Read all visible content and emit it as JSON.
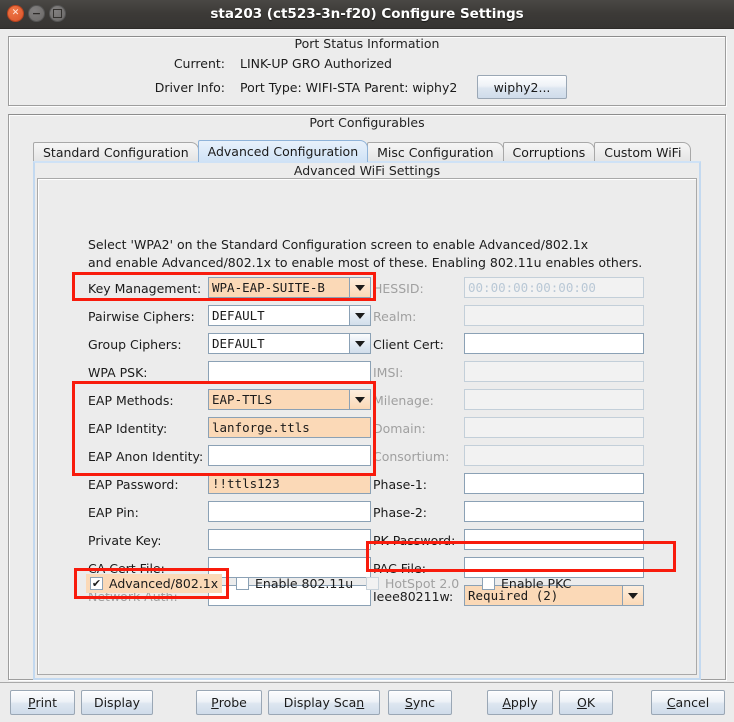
{
  "window": {
    "title": "sta203  (ct523-3n-f20) Configure Settings",
    "controls": [
      {
        "name": "close-button",
        "glyph": "✕"
      },
      {
        "name": "minimize-button",
        "glyph": "−"
      },
      {
        "name": "maximize-button",
        "glyph": ""
      }
    ]
  },
  "port_status": {
    "group_title": "Port Status Information",
    "current_label": "Current:",
    "current_value": "LINK-UP GRO  Authorized",
    "driver_label": "Driver Info:",
    "driver_value": "Port Type: WIFI-STA   Parent: wiphy2",
    "wiphy_button": "wiphy2..."
  },
  "configurables": {
    "group_title": "Port Configurables",
    "tabs": [
      {
        "label": "Standard Configuration",
        "active": false
      },
      {
        "label": "Advanced Configuration",
        "active": true
      },
      {
        "label": "Misc Configuration",
        "active": false
      },
      {
        "label": "Corruptions",
        "active": false
      },
      {
        "label": "Custom WiFi",
        "active": false
      }
    ],
    "panel_title": "Advanced WiFi Settings"
  },
  "hint": {
    "line1": "Select 'WPA2' on the Standard Configuration screen to enable Advanced/802.1x",
    "line2": "and enable Advanced/802.1x to enable most of these. Enabling 802.11u enables others."
  },
  "left_fields": [
    {
      "label": "Key Management:",
      "type": "combo",
      "value": "WPA-EAP-SUITE-B",
      "filled": true,
      "disabled": false
    },
    {
      "label": "Pairwise Ciphers:",
      "type": "combo",
      "value": "DEFAULT",
      "filled": false,
      "disabled": false
    },
    {
      "label": "Group Ciphers:",
      "type": "combo",
      "value": "DEFAULT",
      "filled": false,
      "disabled": false
    },
    {
      "label": "WPA PSK:",
      "type": "text",
      "value": "",
      "filled": false,
      "disabled": false
    },
    {
      "label": "EAP Methods:",
      "type": "combo",
      "value": "EAP-TTLS",
      "filled": true,
      "disabled": false
    },
    {
      "label": "EAP Identity:",
      "type": "text",
      "value": "lanforge.ttls",
      "filled": true,
      "disabled": false
    },
    {
      "label": "EAP Anon Identity:",
      "type": "text",
      "value": "",
      "filled": false,
      "disabled": false
    },
    {
      "label": "EAP Password:",
      "type": "text",
      "value": "!!ttls123",
      "filled": true,
      "disabled": false
    },
    {
      "label": "EAP Pin:",
      "type": "text",
      "value": "",
      "filled": false,
      "disabled": false
    },
    {
      "label": "Private Key:",
      "type": "text",
      "value": "",
      "filled": false,
      "disabled": false
    },
    {
      "label": "CA Cert File:",
      "type": "text",
      "value": "",
      "filled": false,
      "disabled": false
    },
    {
      "label": "Network Auth:",
      "type": "text",
      "value": "",
      "filled": false,
      "disabled": true
    }
  ],
  "right_fields": [
    {
      "label": "HESSID:",
      "type": "text",
      "value": "00:00:00:00:00:00",
      "filled": false,
      "disabled": true,
      "placeholder_style": true
    },
    {
      "label": "Realm:",
      "type": "text",
      "value": "",
      "filled": false,
      "disabled": true
    },
    {
      "label": "Client Cert:",
      "type": "text",
      "value": "",
      "filled": false,
      "disabled": false
    },
    {
      "label": "IMSI:",
      "type": "text",
      "value": "",
      "filled": false,
      "disabled": true
    },
    {
      "label": "Milenage:",
      "type": "text",
      "value": "",
      "filled": false,
      "disabled": true
    },
    {
      "label": "Domain:",
      "type": "text",
      "value": "",
      "filled": false,
      "disabled": true
    },
    {
      "label": "Consortium:",
      "type": "text",
      "value": "",
      "filled": false,
      "disabled": true
    },
    {
      "label": "Phase-1:",
      "type": "text",
      "value": "",
      "filled": false,
      "disabled": false
    },
    {
      "label": "Phase-2:",
      "type": "text",
      "value": "",
      "filled": false,
      "disabled": false
    },
    {
      "label": "PK Password:",
      "type": "text",
      "value": "",
      "filled": false,
      "disabled": false
    },
    {
      "label": "PAC File:",
      "type": "text",
      "value": "",
      "filled": false,
      "disabled": false
    },
    {
      "label": "Ieee80211w:",
      "type": "combo",
      "value": "Required (2)",
      "filled": true,
      "disabled": false
    }
  ],
  "checkboxes": [
    {
      "label": "Advanced/802.1x",
      "checked": true,
      "disabled": false,
      "highlighted": true
    },
    {
      "label": "Enable 802.11u",
      "checked": false,
      "disabled": false,
      "highlighted": false
    },
    {
      "label": "HotSpot 2.0",
      "checked": false,
      "disabled": true,
      "highlighted": false
    },
    {
      "label": "Enable PKC",
      "checked": false,
      "disabled": false,
      "highlighted": false
    }
  ],
  "buttons": [
    {
      "label": "Print",
      "mnemonic": "P"
    },
    {
      "label": "Display",
      "mnemonic": ""
    },
    {
      "label": "Probe",
      "mnemonic": "P"
    },
    {
      "label": "Display Scan",
      "mnemonic": "n"
    },
    {
      "label": "Sync",
      "mnemonic": "S"
    },
    {
      "label": "Apply",
      "mnemonic": "A"
    },
    {
      "label": "OK",
      "mnemonic": "O"
    },
    {
      "label": "Cancel",
      "mnemonic": "C"
    }
  ],
  "colors": {
    "highlight_field": "#fbd9b7",
    "annotation": "#f81b0c",
    "titlebar": "#3c3a37",
    "close_button": "#e0562c"
  }
}
